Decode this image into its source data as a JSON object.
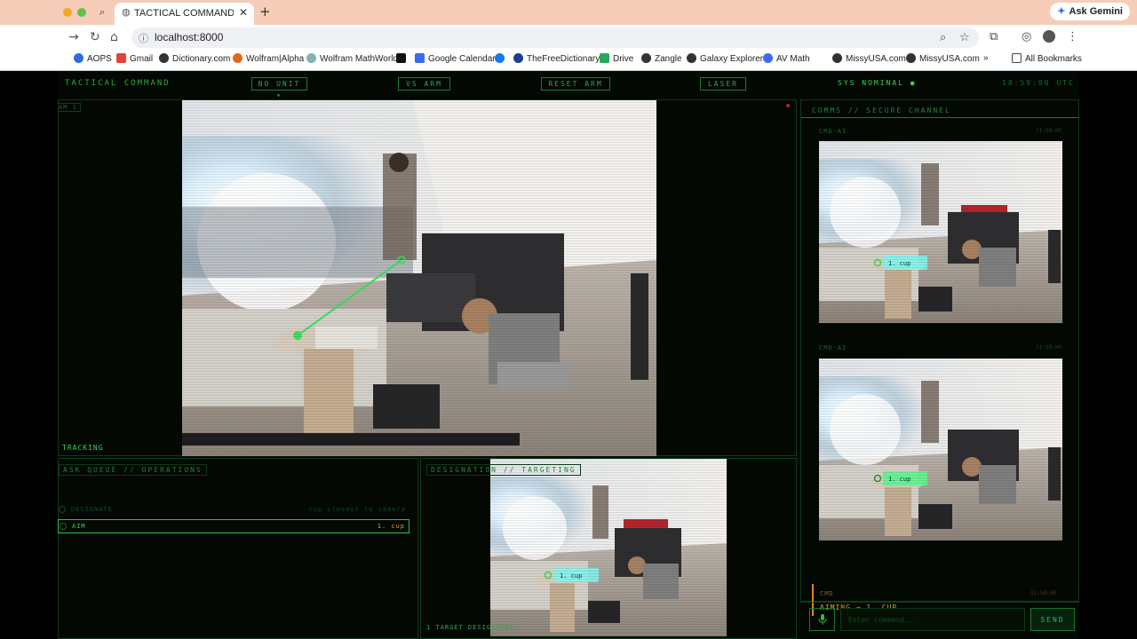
{
  "browser": {
    "tab_title": "TACTICAL COMMAND // SIMP",
    "url": "localhost:8000",
    "gemini_label": "Ask Gemini",
    "bookmarks": [
      "AOPS",
      "Gmail",
      "Dictionary.com",
      "Wolfram|Alpha",
      "Wolfram MathWorld",
      "Google Calendar",
      "TheFreeDictionary",
      "Drive",
      "Zangle",
      "Galaxy Explorer",
      "AV Math",
      "MissyUSA.com",
      "MissyUSA.com"
    ],
    "all_bookmarks": "All Bookmarks"
  },
  "app": {
    "brand": "TACTICAL COMMAND",
    "buttons": {
      "unit": "NO UNIT ▾",
      "arm": "VS ARM",
      "reset": "RESET ARM",
      "laser": "LASER"
    },
    "status": "SYS NOMINAL ●",
    "clock": "18:59:00 UTC",
    "camera": {
      "label": "AM 1",
      "status": "TRACKING"
    },
    "queue": {
      "header": "ASK QUEUE // OPERATIONS",
      "items": [
        {
          "label": "DESIGNATE",
          "detail": "cup closest to camera"
        },
        {
          "label": "AIM",
          "detail": "1. cup"
        }
      ]
    },
    "designation": {
      "header": "DESIGNATION // TARGETING",
      "footer": "1 TARGET DESIGNATED",
      "target_label": "1. cup"
    },
    "comms": {
      "header": "COMMS // SECURE CHANNEL",
      "messages": [
        {
          "sender": "CMD-AI",
          "time": "11:58:00",
          "target_label": "1. cup"
        },
        {
          "sender": "CMD-AI",
          "time": "11:58:00",
          "target_label": "1. cup"
        }
      ],
      "command": {
        "sender": "CMD",
        "time": "11:58:00",
        "text": "AIMING → 1. CUP"
      }
    },
    "input": {
      "placeholder": "Enter command...",
      "send": "SEND"
    }
  }
}
